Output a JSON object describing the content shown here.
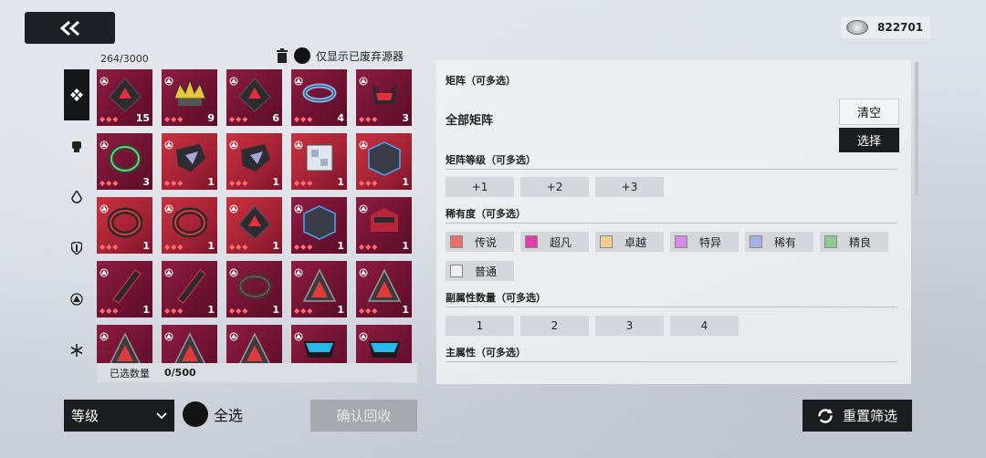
{
  "currency": {
    "value": "822701",
    "icon": "silver-coin-icon"
  },
  "inventory": {
    "count": "264/3000",
    "discard_toggle_label": "仅显示已废弃源器"
  },
  "side_tabs": [
    "all-icon",
    "fist-icon",
    "drop-icon",
    "shield-icon",
    "triangle-icon",
    "snowflake-icon"
  ],
  "grid": [
    {
      "count": "15",
      "style": "dark",
      "art": "pyramid"
    },
    {
      "count": "9",
      "style": "dark",
      "art": "crown"
    },
    {
      "count": "6",
      "style": "dark",
      "art": "pyramid"
    },
    {
      "count": "4",
      "style": "dark",
      "art": "ring"
    },
    {
      "count": "3",
      "style": "dark",
      "art": "horn"
    },
    {
      "count": "3",
      "style": "dark",
      "art": "green-ring"
    },
    {
      "count": "1",
      "style": "red",
      "art": "glove"
    },
    {
      "count": "1",
      "style": "red",
      "art": "glove"
    },
    {
      "count": "1",
      "style": "red",
      "art": "cube"
    },
    {
      "count": "1",
      "style": "red",
      "art": "cube-dark"
    },
    {
      "count": "1",
      "style": "red",
      "art": "ring-red"
    },
    {
      "count": "1",
      "style": "red",
      "art": "ring-red"
    },
    {
      "count": "1",
      "style": "red",
      "art": "pyramid"
    },
    {
      "count": "1",
      "style": "dark",
      "art": "cube-dark"
    },
    {
      "count": "1",
      "style": "dark",
      "art": "helmet"
    },
    {
      "count": "1",
      "style": "dark",
      "art": "blade"
    },
    {
      "count": "1",
      "style": "dark",
      "art": "blade"
    },
    {
      "count": "1",
      "style": "dark",
      "art": "ring-dark"
    },
    {
      "count": "1",
      "style": "dark",
      "art": "prism"
    },
    {
      "count": "1",
      "style": "dark",
      "art": "prism"
    },
    {
      "count": "",
      "style": "dark",
      "art": "prism"
    },
    {
      "count": "",
      "style": "dark",
      "art": "prism"
    },
    {
      "count": "",
      "style": "dark",
      "art": "prism"
    },
    {
      "count": "",
      "style": "dark",
      "art": "visor"
    },
    {
      "count": "",
      "style": "dark",
      "art": "visor"
    }
  ],
  "selected": {
    "label": "已选数量",
    "value": "0/500"
  },
  "filters": {
    "matrix": {
      "title": "矩阵（可多选）",
      "value": "全部矩阵",
      "clear": "清空",
      "choose": "选择"
    },
    "matrix_level": {
      "title": "矩阵等级（可多选）",
      "options": [
        "+1",
        "+2",
        "+3"
      ]
    },
    "rarity": {
      "title": "稀有度（可多选）",
      "options": [
        {
          "label": "传说",
          "color": "#e86f6a"
        },
        {
          "label": "超凡",
          "color": "#e03ea8"
        },
        {
          "label": "卓越",
          "color": "#f3cf8e"
        },
        {
          "label": "特异",
          "color": "#d58ae6"
        },
        {
          "label": "稀有",
          "color": "#a5b2e6"
        },
        {
          "label": "精良",
          "color": "#8fca93"
        },
        {
          "label": "普通",
          "color": "#eeeeee"
        }
      ]
    },
    "substat_count": {
      "title": "副属性数量（可多选）",
      "options": [
        "1",
        "2",
        "3",
        "4"
      ]
    },
    "main_stat": {
      "title": "主属性（可多选）"
    }
  },
  "bottom": {
    "sort": "等级",
    "select_all": "全选",
    "confirm": "确认回收",
    "reset": "重置筛选"
  }
}
